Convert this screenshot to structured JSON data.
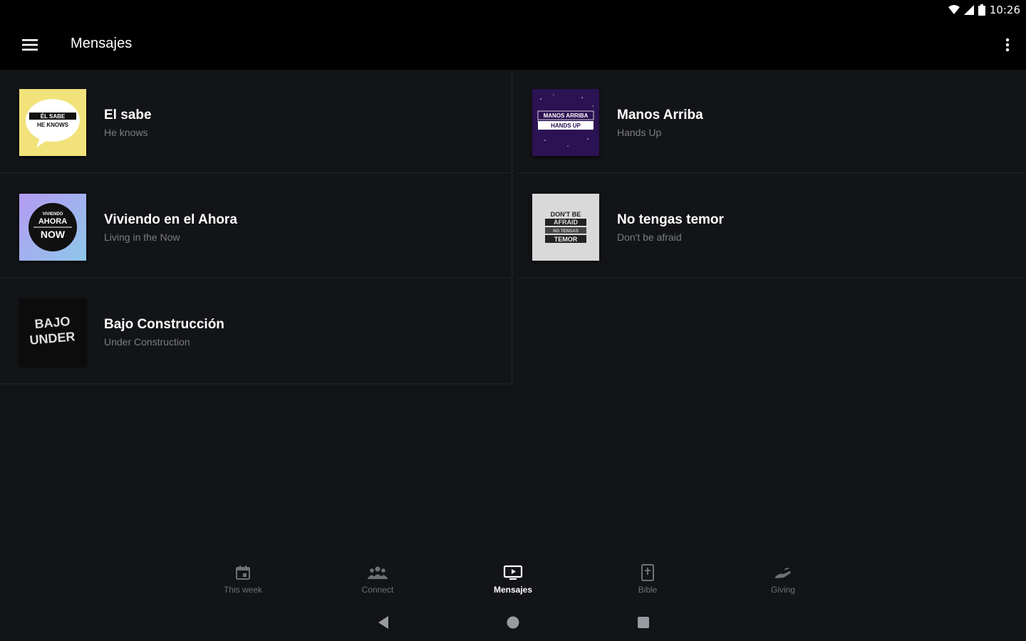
{
  "status_bar": {
    "time": "10:26"
  },
  "app_bar": {
    "title": "Mensajes"
  },
  "messages": [
    {
      "title": "El sabe",
      "subtitle": "He knows",
      "thumb_text": [
        "ÉL SABE",
        "HE KNOWS"
      ]
    },
    {
      "title": "Manos Arriba",
      "subtitle": "Hands Up",
      "thumb_text": [
        "MANOS ARRIBA",
        "HANDS UP"
      ]
    },
    {
      "title": "Viviendo en el Ahora",
      "subtitle": "Living in the Now",
      "thumb_text": [
        "VIVIENDO",
        "AHORA",
        "NOW"
      ]
    },
    {
      "title": "No tengas temor",
      "subtitle": "Don't be afraid",
      "thumb_text": [
        "DON'T BE",
        "AFRAID",
        "NO TENGAS",
        "TEMOR"
      ]
    },
    {
      "title": "Bajo Construcción",
      "subtitle": "Under Construction",
      "thumb_text": [
        "BAJO",
        "UNDER"
      ]
    }
  ],
  "bottom_nav": [
    {
      "label": "This week",
      "icon": "calendar-icon",
      "active": false
    },
    {
      "label": "Connect",
      "icon": "people-icon",
      "active": false
    },
    {
      "label": "Mensajes",
      "icon": "tv-play-icon",
      "active": true
    },
    {
      "label": "Bible",
      "icon": "bible-icon",
      "active": false
    },
    {
      "label": "Giving",
      "icon": "giving-hand-icon",
      "active": false
    }
  ],
  "colors": {
    "background": "#131417",
    "app_bar": "#000000",
    "subtitle": "#7b7d82",
    "thumb_el_sabe": "#f2e27a",
    "thumb_manos_arriba": "#2b1252",
    "thumb_viviendo": "#a89ff0"
  }
}
